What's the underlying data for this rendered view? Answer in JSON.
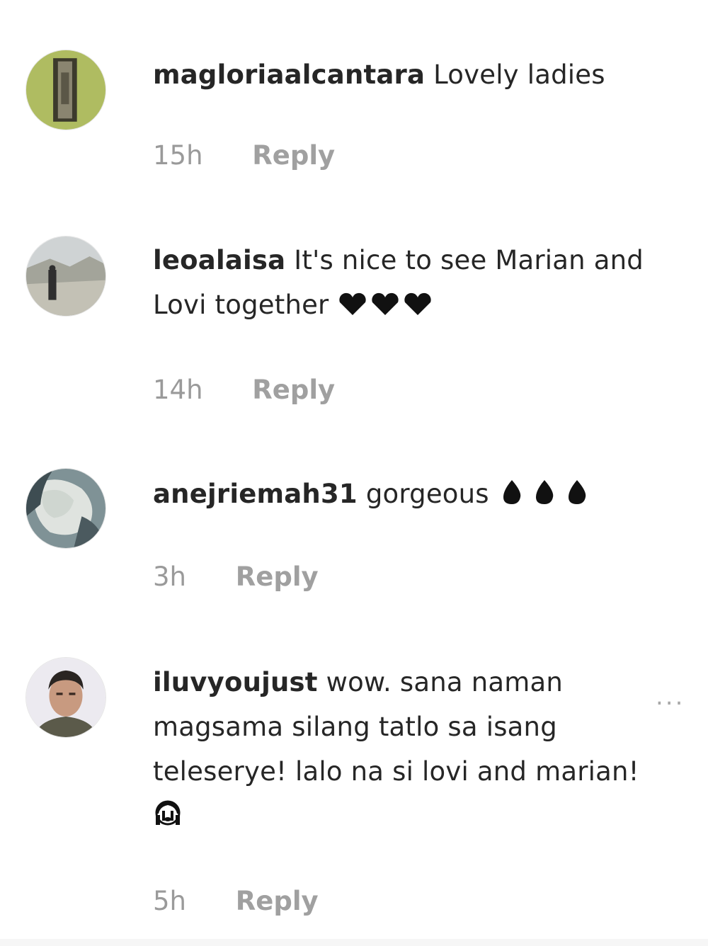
{
  "comments": [
    {
      "username": "magloriaalcantara",
      "text": "Lovely ladies",
      "time": "15h",
      "reply": "Reply",
      "avatar_icon": "avatar-person-standing-icon",
      "emoji": ""
    },
    {
      "username": "leoalaisa",
      "text": "It's nice to see Marian and Lovi together",
      "time": "14h",
      "reply": "Reply",
      "avatar_icon": "avatar-landscape-person-icon",
      "emoji": "black-hearts"
    },
    {
      "username": "anejriemah31",
      "text": "gorgeous",
      "time": "3h",
      "reply": "Reply",
      "avatar_icon": "avatar-portrait-icon",
      "emoji": "fire"
    },
    {
      "username": "iluvyoujust",
      "text": "wow. sana naman magsama silang tatlo sa isang teleserye! lalo na si lovi and marian!",
      "time": "5h",
      "reply": "Reply",
      "avatar_icon": "avatar-man-face-icon",
      "emoji": "crying-face"
    }
  ],
  "more_options": "...",
  "colors": {
    "text": "#262626",
    "meta": "#9a9a9a"
  }
}
